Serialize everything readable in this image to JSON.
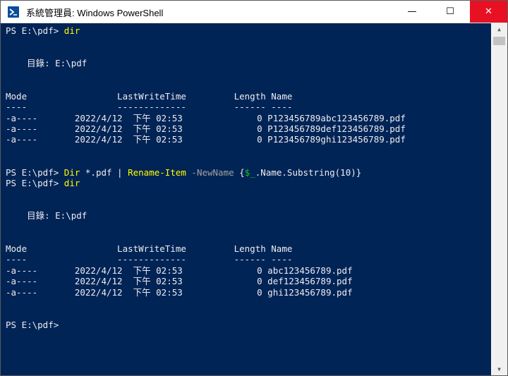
{
  "window": {
    "title": "系統管理員: Windows PowerShell",
    "minimize_glyph": "—",
    "maximize_glyph": "☐",
    "close_glyph": "✕",
    "titlebar_color": "#ffffff",
    "close_color": "#e81123"
  },
  "console": {
    "background": "#012456",
    "lines": [
      {
        "segments": [
          {
            "text": "PS E:\\pdf> ",
            "color": "white"
          },
          {
            "text": "dir",
            "color": "yellow"
          }
        ]
      },
      {
        "segments": []
      },
      {
        "segments": []
      },
      {
        "segments": [
          {
            "text": "    目錄: E:\\pdf",
            "color": "white"
          }
        ]
      },
      {
        "segments": []
      },
      {
        "segments": []
      },
      {
        "segments": [
          {
            "text": "Mode                 LastWriteTime         Length Name",
            "color": "white"
          }
        ]
      },
      {
        "segments": [
          {
            "text": "----                 -------------         ------ ----",
            "color": "white"
          }
        ]
      },
      {
        "segments": [
          {
            "text": "-a----       2022/4/12  下午 02:53              0 P123456789abc123456789.pdf",
            "color": "white"
          }
        ]
      },
      {
        "segments": [
          {
            "text": "-a----       2022/4/12  下午 02:53              0 P123456789def123456789.pdf",
            "color": "white"
          }
        ]
      },
      {
        "segments": [
          {
            "text": "-a----       2022/4/12  下午 02:53              0 P123456789ghi123456789.pdf",
            "color": "white"
          }
        ]
      },
      {
        "segments": []
      },
      {
        "segments": []
      },
      {
        "segments": [
          {
            "text": "PS E:\\pdf> ",
            "color": "white"
          },
          {
            "text": "Dir",
            "color": "yellow"
          },
          {
            "text": " *.pdf | ",
            "color": "white"
          },
          {
            "text": "Rename-Item",
            "color": "yellow"
          },
          {
            "text": " -NewName",
            "color": "gray"
          },
          {
            "text": " {",
            "color": "white"
          },
          {
            "text": "$_",
            "color": "green"
          },
          {
            "text": ".Name.Substring(10)}",
            "color": "white"
          }
        ]
      },
      {
        "segments": [
          {
            "text": "PS E:\\pdf> ",
            "color": "white"
          },
          {
            "text": "dir",
            "color": "yellow"
          }
        ]
      },
      {
        "segments": []
      },
      {
        "segments": []
      },
      {
        "segments": [
          {
            "text": "    目錄: E:\\pdf",
            "color": "white"
          }
        ]
      },
      {
        "segments": []
      },
      {
        "segments": []
      },
      {
        "segments": [
          {
            "text": "Mode                 LastWriteTime         Length Name",
            "color": "white"
          }
        ]
      },
      {
        "segments": [
          {
            "text": "----                 -------------         ------ ----",
            "color": "white"
          }
        ]
      },
      {
        "segments": [
          {
            "text": "-a----       2022/4/12  下午 02:53              0 abc123456789.pdf",
            "color": "white"
          }
        ]
      },
      {
        "segments": [
          {
            "text": "-a----       2022/4/12  下午 02:53              0 def123456789.pdf",
            "color": "white"
          }
        ]
      },
      {
        "segments": [
          {
            "text": "-a----       2022/4/12  下午 02:53              0 ghi123456789.pdf",
            "color": "white"
          }
        ]
      },
      {
        "segments": []
      },
      {
        "segments": []
      },
      {
        "segments": [
          {
            "text": "PS E:\\pdf>",
            "color": "white"
          }
        ]
      }
    ]
  },
  "scrollbar": {
    "up_glyph": "▲",
    "down_glyph": "▼"
  }
}
